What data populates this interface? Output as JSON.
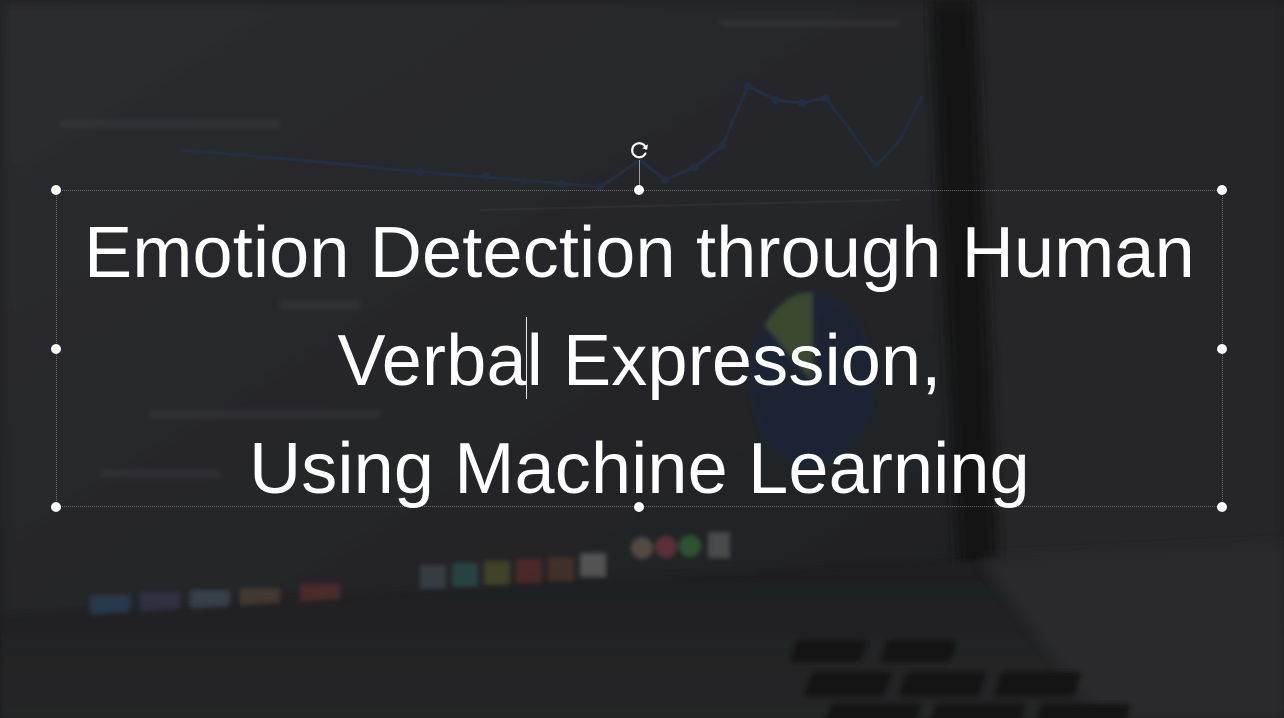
{
  "slide": {
    "title_lines": [
      "Emotion Detection through Human",
      "Verbal Expression,",
      "Using Machine Learning"
    ],
    "caret_split": [
      "Verba",
      "l Expression,"
    ]
  },
  "colors": {
    "text": "#ffffff",
    "background": "#1f2023",
    "handle": "#ffffff"
  },
  "icons": {
    "rotate": "rotate-icon"
  }
}
